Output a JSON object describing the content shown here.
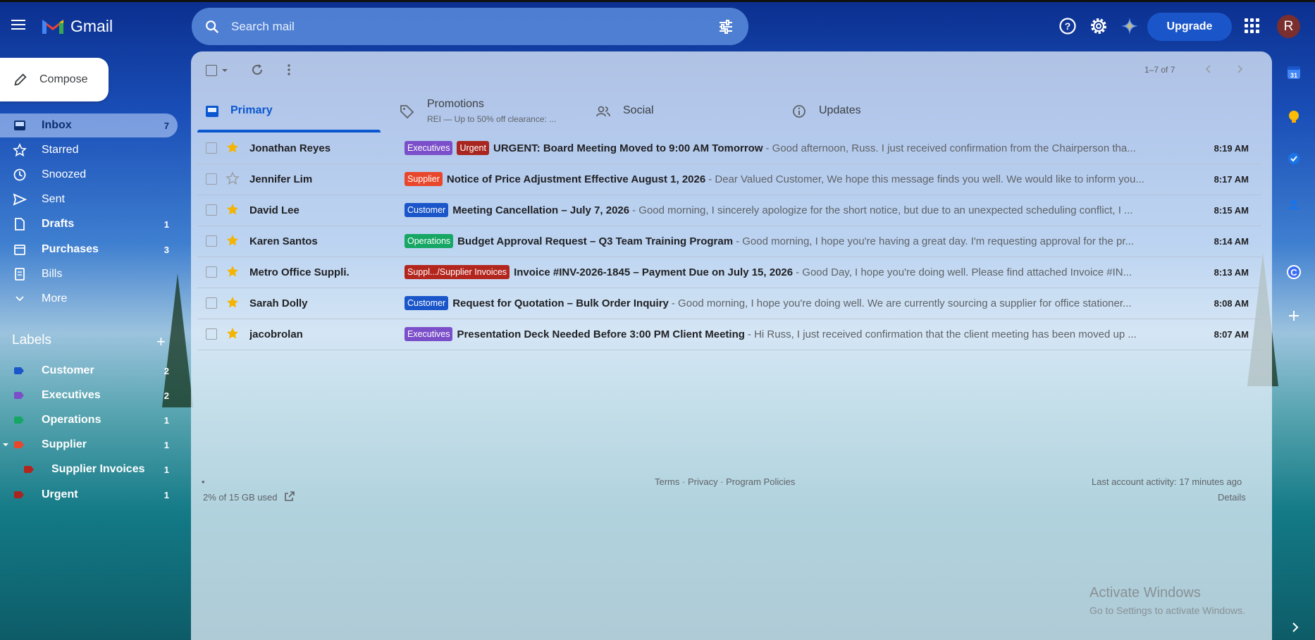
{
  "app": {
    "name": "Gmail"
  },
  "search": {
    "placeholder": "Search mail"
  },
  "header": {
    "upgrade_label": "Upgrade",
    "avatar_letter": "R"
  },
  "compose": {
    "label": "Compose"
  },
  "nav": [
    {
      "label": "Inbox",
      "count": "7",
      "icon": "inbox-icon"
    },
    {
      "label": "Starred",
      "count": "",
      "icon": "star-icon"
    },
    {
      "label": "Snoozed",
      "count": "",
      "icon": "clock-icon"
    },
    {
      "label": "Sent",
      "count": "",
      "icon": "send-icon"
    },
    {
      "label": "Drafts",
      "count": "1",
      "icon": "draft-icon"
    },
    {
      "label": "Purchases",
      "count": "3",
      "icon": "purchases-icon"
    },
    {
      "label": "Bills",
      "count": "",
      "icon": "bills-icon"
    },
    {
      "label": "More",
      "count": "",
      "icon": "chevron-down-icon"
    }
  ],
  "labels": {
    "title": "Labels",
    "items": [
      {
        "label": "Customer",
        "count": "2",
        "color": "#1a56c9"
      },
      {
        "label": "Executives",
        "count": "2",
        "color": "#7b4fc9"
      },
      {
        "label": "Operations",
        "count": "1",
        "color": "#16a765"
      },
      {
        "label": "Supplier",
        "count": "1",
        "color": "#e8472b"
      },
      {
        "label": "Supplier Invoices",
        "count": "1",
        "color": "#b3261e"
      },
      {
        "label": "Urgent",
        "count": "1",
        "color": "#a8261f"
      }
    ]
  },
  "toolbar": {
    "pager": "1–7 of 7"
  },
  "tabs": [
    {
      "label": "Primary",
      "sub": ""
    },
    {
      "label": "Promotions",
      "sub": "REI — Up to 50% off clearance: ..."
    },
    {
      "label": "Social",
      "sub": ""
    },
    {
      "label": "Updates",
      "sub": ""
    }
  ],
  "emails": [
    {
      "sender": "Jonathan Reyes",
      "labels": [
        {
          "text": "Executives",
          "color": "#7b4fc9"
        },
        {
          "text": "Urgent",
          "color": "#a8261f"
        }
      ],
      "subject": "URGENT: Board Meeting Moved to 9:00 AM Tomorrow",
      "snippet": "- Good afternoon, Russ. I just received confirmation from the Chairperson tha...",
      "time": "8:19 AM",
      "starred": true
    },
    {
      "sender": "Jennifer Lim",
      "labels": [
        {
          "text": "Supplier",
          "color": "#e8472b"
        }
      ],
      "subject": "Notice of Price Adjustment Effective August 1, 2026",
      "snippet": "- Dear Valued Customer, We hope this message finds you well. We would like to inform you...",
      "time": "8:17 AM",
      "starred": false
    },
    {
      "sender": "David Lee",
      "labels": [
        {
          "text": "Customer",
          "color": "#1a56c9"
        }
      ],
      "subject": "Meeting Cancellation – July 7, 2026",
      "snippet": "- Good morning, I sincerely apologize for the short notice, but due to an unexpected scheduling conflict, I ...",
      "time": "8:15 AM",
      "starred": true
    },
    {
      "sender": "Karen Santos",
      "labels": [
        {
          "text": "Operations",
          "color": "#16a765"
        }
      ],
      "subject": "Budget Approval Request – Q3 Team Training Program",
      "snippet": "- Good morning, I hope you're having a great day. I'm requesting approval for the pr...",
      "time": "8:14 AM",
      "starred": true
    },
    {
      "sender": "Metro Office Suppli.",
      "labels": [
        {
          "text": "Suppl.../Supplier Invoices",
          "color": "#b3261e"
        }
      ],
      "subject": "Invoice #INV-2026-1845 – Payment Due on July 15, 2026",
      "snippet": "- Good Day, I hope you're doing well. Please find attached Invoice #IN...",
      "time": "8:13 AM",
      "starred": true
    },
    {
      "sender": "Sarah Dolly",
      "labels": [
        {
          "text": "Customer",
          "color": "#1a56c9"
        }
      ],
      "subject": "Request for Quotation – Bulk Order Inquiry",
      "snippet": "- Good morning, I hope you're doing well. We are currently sourcing a supplier for office stationer...",
      "time": "8:08 AM",
      "starred": true
    },
    {
      "sender": "jacobrolan",
      "labels": [
        {
          "text": "Executives",
          "color": "#7b4fc9"
        }
      ],
      "subject": "Presentation Deck Needed Before 3:00 PM Client Meeting",
      "snippet": "- Hi Russ, I just received confirmation that the client meeting has been moved up ...",
      "time": "8:07 AM",
      "starred": true
    }
  ],
  "footer": {
    "storage": "2% of 15 GB used",
    "terms": "Terms",
    "privacy": "Privacy",
    "policies": "Program Policies",
    "activity": "Last account activity: 17 minutes ago",
    "details": "Details",
    "dot": "•"
  },
  "watermark": {
    "line1": "Activate Windows",
    "line2": "Go to Settings to activate Windows."
  },
  "accent_color": "#0b57d0"
}
